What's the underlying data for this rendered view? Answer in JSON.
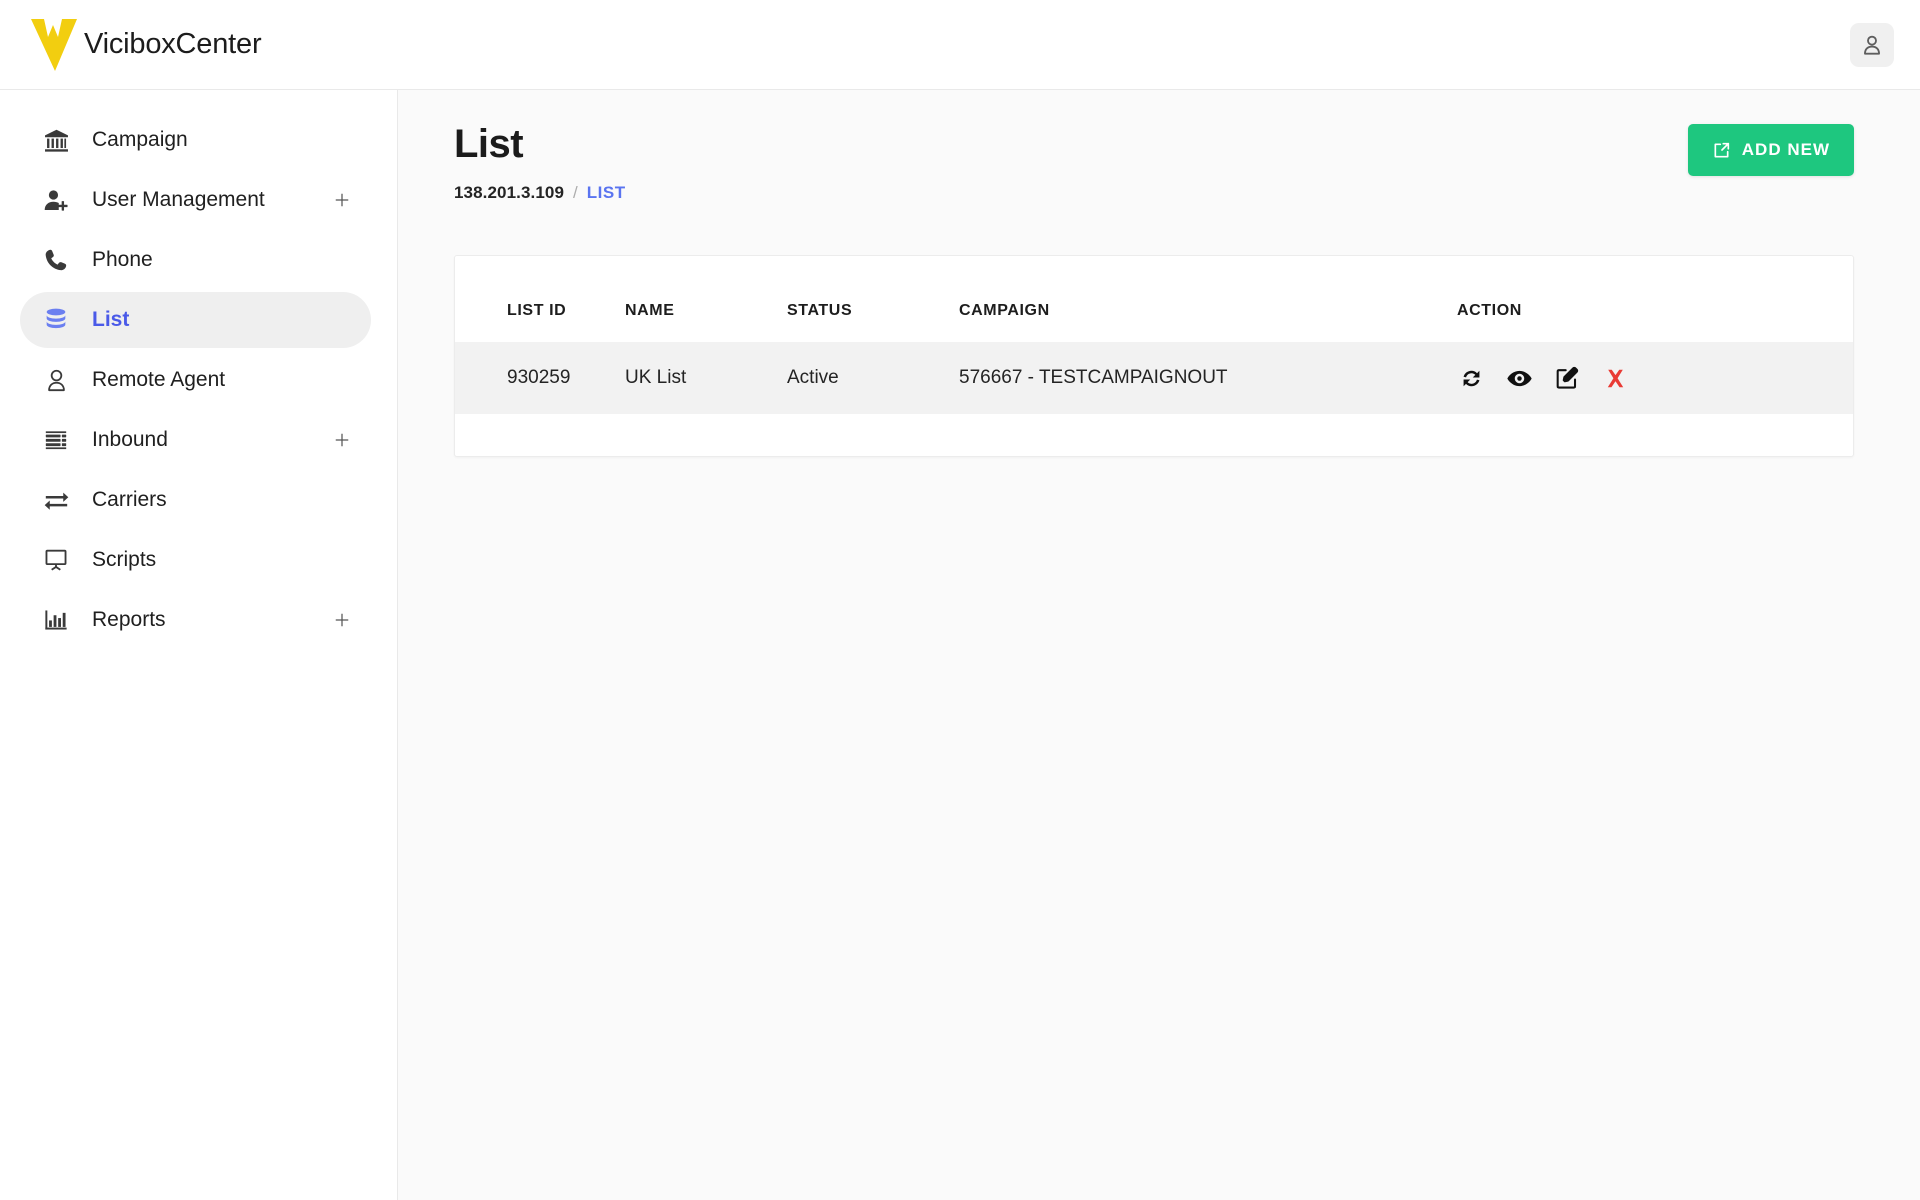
{
  "brand": {
    "name": "ViciboxCenter",
    "logo_icon": "vicibox-v-logo",
    "logo_color": "#f2ce10"
  },
  "topbar": {
    "account_icon": "user-icon"
  },
  "sidebar": {
    "items": [
      {
        "label": "Campaign",
        "icon": "bank-icon",
        "active": false,
        "expandable": false
      },
      {
        "label": "User Management",
        "icon": "user-plus-icon",
        "active": false,
        "expandable": true
      },
      {
        "label": "Phone",
        "icon": "phone-icon",
        "active": false,
        "expandable": false
      },
      {
        "label": "List",
        "icon": "database-icon",
        "active": true,
        "expandable": false
      },
      {
        "label": "Remote Agent",
        "icon": "user-circle-icon",
        "active": false,
        "expandable": false
      },
      {
        "label": "Inbound",
        "icon": "server-list-icon",
        "active": false,
        "expandable": true
      },
      {
        "label": "Carriers",
        "icon": "exchange-icon",
        "active": false,
        "expandable": false
      },
      {
        "label": "Scripts",
        "icon": "presentation-icon",
        "active": false,
        "expandable": false
      },
      {
        "label": "Reports",
        "icon": "bar-chart-icon",
        "active": false,
        "expandable": true
      }
    ],
    "expand_icon": "plus-icon",
    "active_label_color": "#4a5ae8"
  },
  "page": {
    "title": "List",
    "breadcrumb": {
      "host": "138.201.3.109",
      "separator": "/",
      "current": "LIST",
      "current_color": "#5a74f0"
    },
    "add_new": {
      "label": "ADD NEW",
      "icon": "external-link-icon",
      "color": "#1ec77f"
    }
  },
  "table": {
    "columns": [
      "LIST ID",
      "NAME",
      "STATUS",
      "CAMPAIGN",
      "ACTION"
    ],
    "rows": [
      {
        "list_id": "930259",
        "name": "UK List",
        "status": "Active",
        "campaign": "576667 - TESTCAMPAIGNOUT",
        "actions": [
          {
            "name": "reload-icon",
            "title": "Reload",
            "color": "#111111"
          },
          {
            "name": "eye-icon",
            "title": "View",
            "color": "#111111"
          },
          {
            "name": "edit-icon",
            "title": "Edit",
            "color": "#111111"
          },
          {
            "name": "delete-icon",
            "title": "Delete",
            "color": "#e93b35"
          }
        ]
      }
    ]
  }
}
